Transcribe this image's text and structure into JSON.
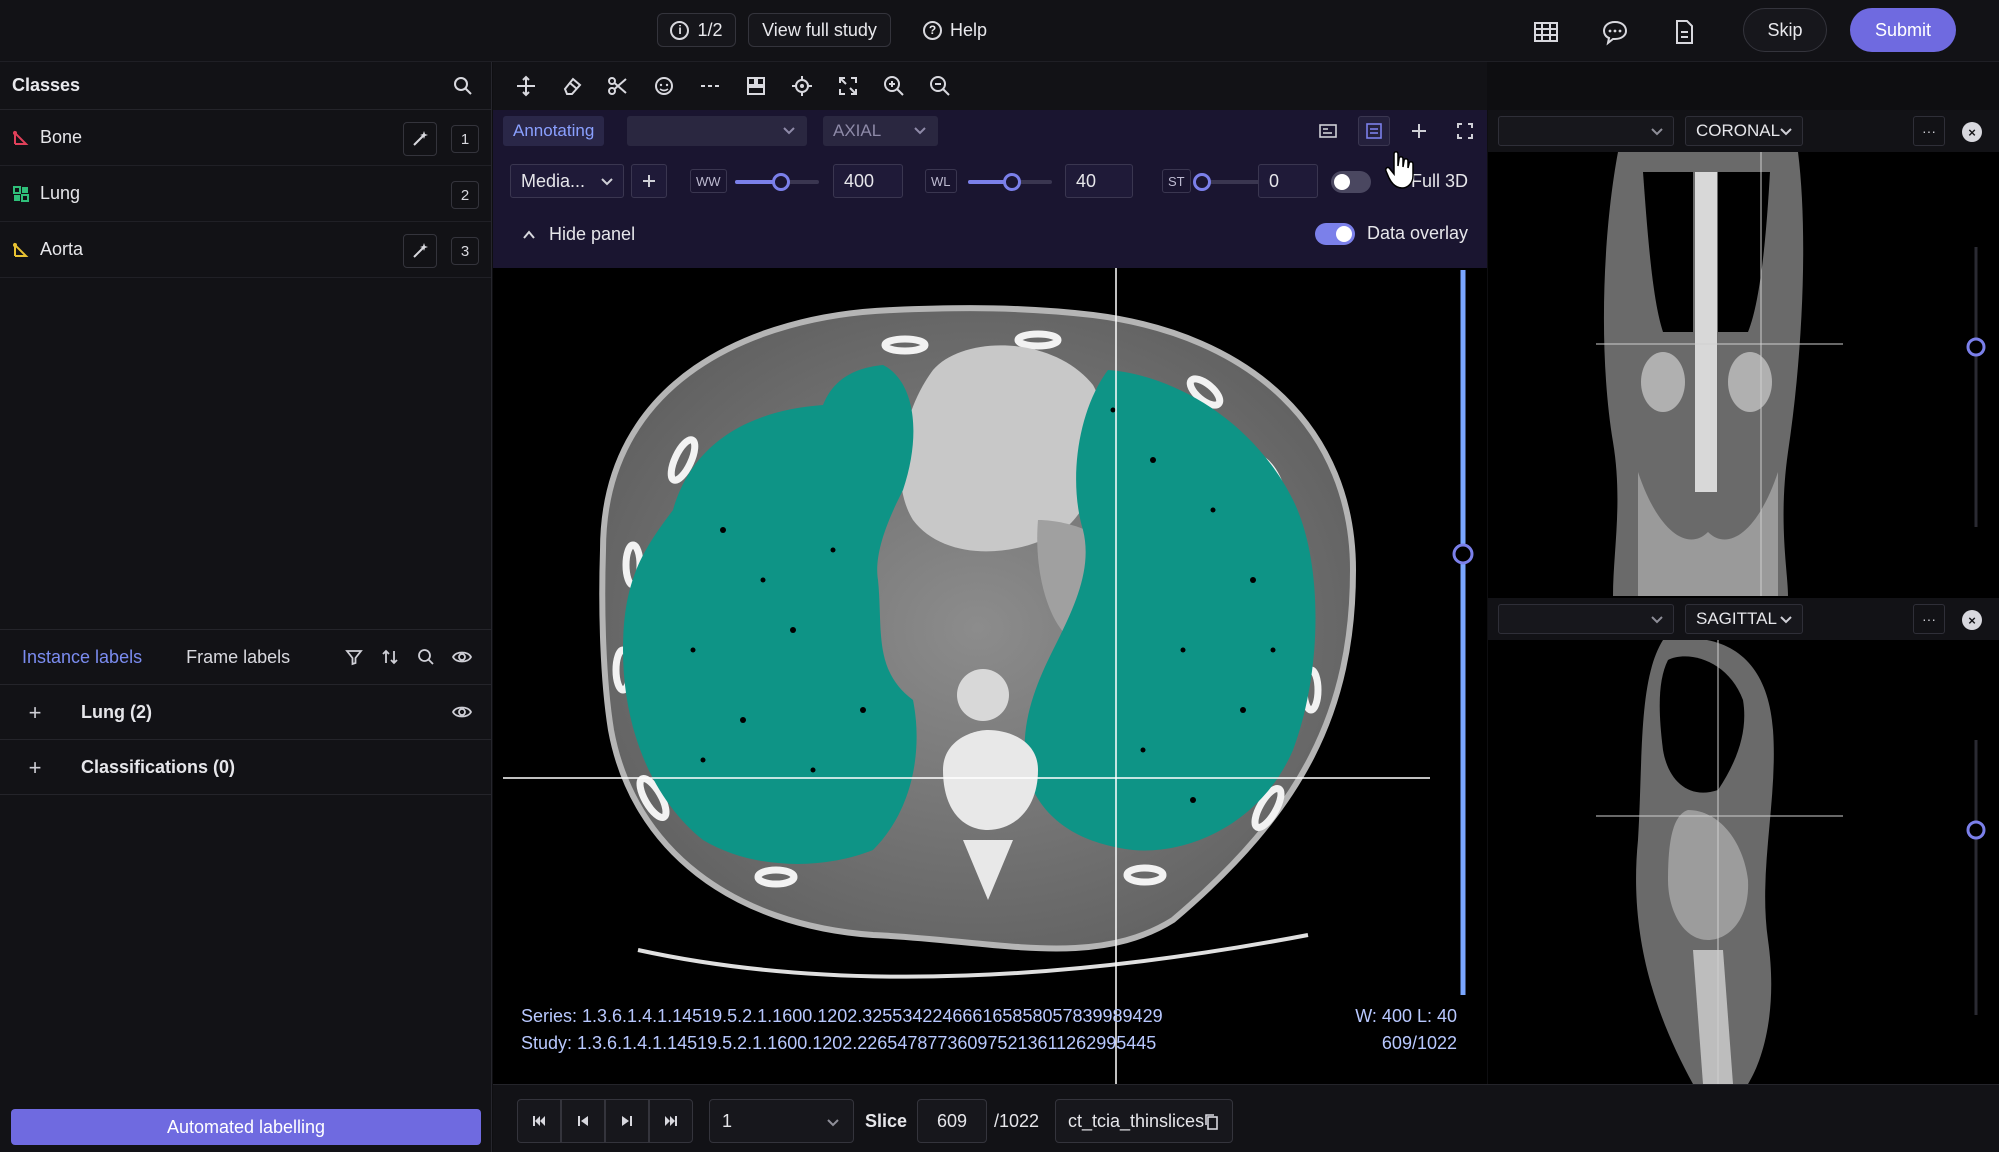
{
  "topbar": {
    "counter": "1/2",
    "view_full_study": "View full study",
    "help": "Help",
    "skip": "Skip",
    "submit": "Submit",
    "icons": [
      "info-icon",
      "help-circle-icon",
      "table-icon",
      "comment-icon",
      "document-icon"
    ]
  },
  "classes": {
    "title": "Classes",
    "items": [
      {
        "name": "Bone",
        "hotkey": "1",
        "color": "#e0405a",
        "icon": "polyline-icon",
        "has_wand": true
      },
      {
        "name": "Lung",
        "hotkey": "2",
        "color": "#2fc07a",
        "icon": "bitmask-icon",
        "has_wand": false
      },
      {
        "name": "Aorta",
        "hotkey": "3",
        "color": "#e8c232",
        "icon": "polyline-icon",
        "has_wand": true
      }
    ]
  },
  "labels_tabs": {
    "instance": "Instance labels",
    "frame": "Frame labels"
  },
  "labels": {
    "lung": "Lung (2)",
    "classifications": "Classifications (0)"
  },
  "automated": "Automated labelling",
  "viewer": {
    "status": "Annotating",
    "view_dropdown": "AXIAL",
    "preset": "Media...",
    "ww_tag": "WW",
    "ww": "400",
    "wl_tag": "WL",
    "wl": "40",
    "st_tag": "ST",
    "st": "0",
    "full3d": "Full 3D",
    "hide_panel": "Hide panel",
    "data_overlay": "Data overlay",
    "series": "Series: 1.3.6.1.4.1.14519.5.2.1.1600.1202.325534224666165858057839989429",
    "study": "Study: 1.3.6.1.4.1.14519.5.2.1.1600.1202.226547877360975213611262995445",
    "wl_readout": "W: 400 L: 40",
    "slice_readout": "609/1022",
    "ww_slider_fraction": 0.55,
    "wl_slider_fraction": 0.52,
    "st_slider_fraction": 0.0,
    "full3d_on": false,
    "overlay_on": true,
    "accent": "#7b80ea",
    "mask_color": "#0e9486"
  },
  "coronal": {
    "view": "CORONAL",
    "more": "···"
  },
  "sagittal": {
    "view": "SAGITTAL",
    "more": "···"
  },
  "bottom": {
    "frame": "1",
    "slice_label": "Slice",
    "slice_value": "609",
    "slice_total": "/1022",
    "dataset": "ct_tcia_thinslices"
  }
}
